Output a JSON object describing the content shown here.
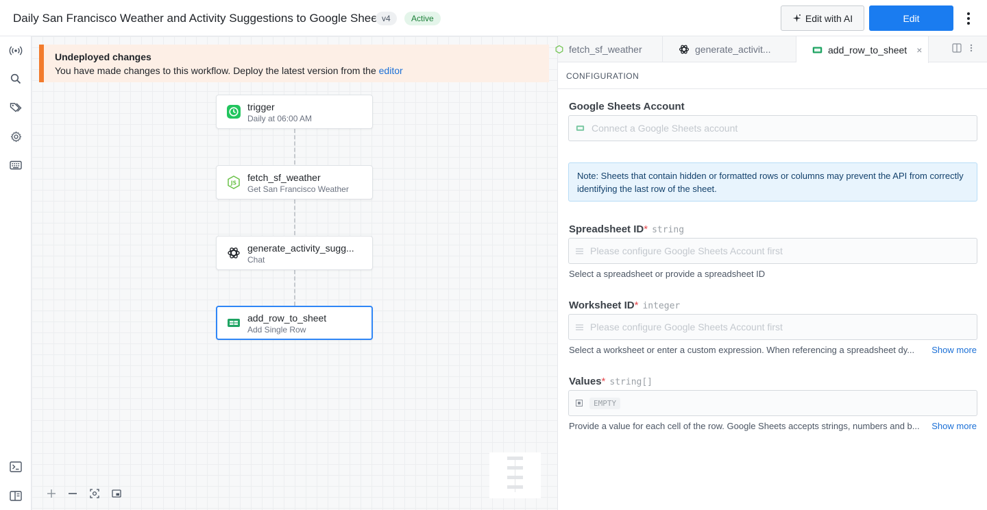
{
  "header": {
    "title": "Daily San Francisco Weather and Activity Suggestions to Google Sheets",
    "version": "v4",
    "status": "Active",
    "edit_ai_label": "Edit with AI",
    "edit_label": "Edit"
  },
  "banner": {
    "title": "Undeployed changes",
    "text": "You have made changes to this workflow. Deploy the latest version from the ",
    "link": "editor"
  },
  "nodes": [
    {
      "title": "trigger",
      "subtitle": "Daily at 06:00 AM"
    },
    {
      "title": "fetch_sf_weather",
      "subtitle": "Get San Francisco Weather"
    },
    {
      "title": "generate_activity_sugg...",
      "subtitle": "Chat"
    },
    {
      "title": "add_row_to_sheet",
      "subtitle": "Add Single Row"
    }
  ],
  "tabs": [
    {
      "label": "fetch_sf_weather"
    },
    {
      "label": "generate_activit..."
    },
    {
      "label": "add_row_to_sheet",
      "close": "×"
    }
  ],
  "config": {
    "section_label": "CONFIGURATION",
    "account": {
      "label": "Google Sheets Account",
      "placeholder": "Connect a Google Sheets account"
    },
    "note": "Note: Sheets that contain hidden or formatted rows or columns may prevent the API from correctly identifying the last row of the sheet.",
    "spreadsheet": {
      "label": "Spreadsheet ID",
      "required": "*",
      "type": "string",
      "placeholder": "Please configure Google Sheets Account first",
      "help": "Select a spreadsheet or provide a spreadsheet ID"
    },
    "worksheet": {
      "label": "Worksheet ID",
      "required": "*",
      "type": "integer",
      "placeholder": "Please configure Google Sheets Account first",
      "help": "Select a worksheet or enter a custom expression. When referencing a spreadsheet dy...",
      "show_more": "Show more"
    },
    "values": {
      "label": "Values",
      "required": "*",
      "type": "string[]",
      "empty": "EMPTY",
      "help": "Provide a value for each cell of the row. Google Sheets accepts strings, numbers and b...",
      "show_more": "Show more"
    }
  },
  "colors": {
    "accent": "#1a7cf0",
    "banner_border": "#f27b2c",
    "active_badge": "#1a7f37",
    "trigger_icon": "#22c55e",
    "sheets_icon": "#1fa463",
    "node_icon": "#6cc24a"
  },
  "icons": {
    "rail": [
      "broadcast-icon",
      "search-icon",
      "tag-icon",
      "gear-icon",
      "keyboard-icon",
      "terminal-icon",
      "panel-icon"
    ]
  }
}
